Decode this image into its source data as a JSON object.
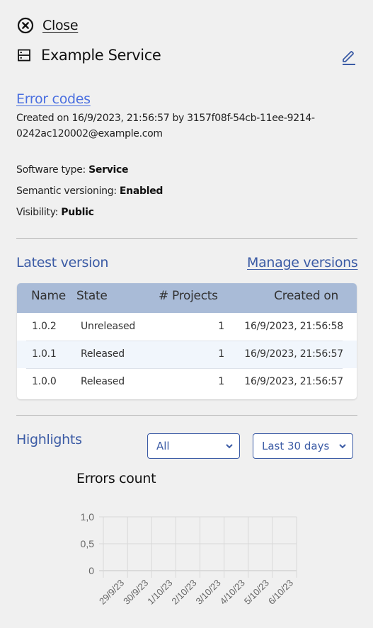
{
  "header": {
    "close_label": "Close",
    "title": "Example Service",
    "icons": {
      "close": "close-circle-icon",
      "service": "service-icon",
      "edit": "edit-pencil-icon"
    }
  },
  "details": {
    "error_codes_link": "Error codes",
    "created_text": "Created on 16/9/2023, 21:56:57 by 3157f08f-54cb-11ee-9214-0242ac120002@example.com",
    "software_type_label": "Software type:",
    "software_type_value": "Service",
    "semver_label": "Semantic versioning:",
    "semver_value": "Enabled",
    "visibility_label": "Visibility:",
    "visibility_value": "Public"
  },
  "versions": {
    "title": "Latest version",
    "manage_link": "Manage versions",
    "columns": [
      "Name",
      "State",
      "# Projects",
      "Created on"
    ],
    "rows": [
      {
        "name": "1.0.2",
        "state": "Unreleased",
        "projects": "1",
        "created": "16/9/2023, 21:56:58"
      },
      {
        "name": "1.0.1",
        "state": "Released",
        "projects": "1",
        "created": "16/9/2023, 21:56:57"
      },
      {
        "name": "1.0.0",
        "state": "Released",
        "projects": "1",
        "created": "16/9/2023, 21:56:57"
      }
    ]
  },
  "highlights": {
    "title": "Highlights",
    "filter_select": {
      "selected": "All"
    },
    "period_select": {
      "selected": "Last 30 days"
    },
    "colors": {
      "accent": "#3b5ba5",
      "link": "#4a6fe0",
      "table_header": "#a9bbd7"
    }
  },
  "chart_data": {
    "type": "line",
    "title": "Errors count",
    "xlabel": "",
    "ylabel": "",
    "categories": [
      "29/9/23",
      "30/9/23",
      "1/10/23",
      "2/10/23",
      "3/10/23",
      "4/10/23",
      "5/10/23",
      "6/10/23"
    ],
    "series": [],
    "y_ticks": [
      "0",
      "0,5",
      "1,0"
    ],
    "y_tick_values": [
      0,
      0.5,
      1.0
    ],
    "ylim": [
      0,
      1.0
    ],
    "grid": true,
    "legend": "none"
  }
}
